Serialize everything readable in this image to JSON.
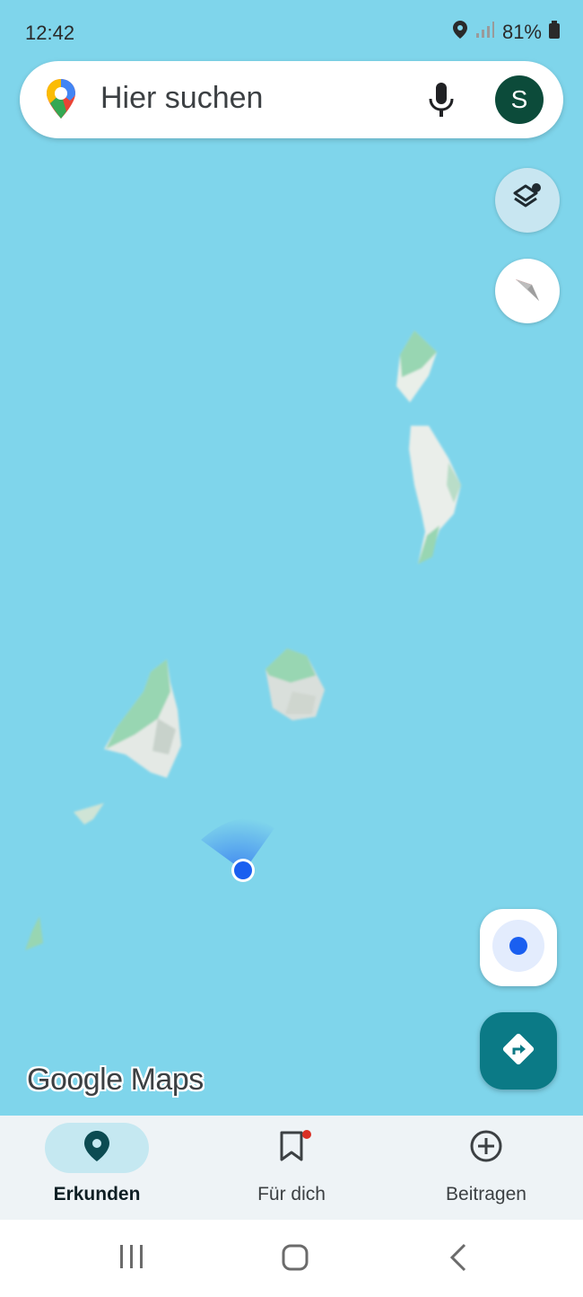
{
  "status_bar": {
    "time": "12:42",
    "battery": "81%",
    "icons": [
      "location-icon",
      "signal-icon",
      "battery-icon"
    ]
  },
  "search": {
    "placeholder": "Hier suchen",
    "avatar_initial": "S",
    "icons": [
      "maps-pin-logo",
      "mic-icon"
    ]
  },
  "map": {
    "watermark": "Google Maps",
    "colors": {
      "water": "#7fd5eb",
      "land": "#e9efe9",
      "vegetation": "#98d6b2",
      "user_dot": "#1a5ff0"
    }
  },
  "map_controls": {
    "layers": "layers-icon",
    "compass": "compass-icon",
    "my_location": "my-location-icon",
    "directions": "directions-icon"
  },
  "bottom_nav": {
    "items": [
      {
        "label": "Erkunden",
        "icon": "explore-pin-icon",
        "active": true
      },
      {
        "label": "Für dich",
        "icon": "bookmark-icon",
        "active": false
      },
      {
        "label": "Beitragen",
        "icon": "add-circle-icon",
        "active": false
      }
    ]
  },
  "system_nav": {
    "icons": [
      "recent-apps-icon",
      "home-icon",
      "back-icon"
    ]
  },
  "colors": {
    "accent": "#0b7a86",
    "avatar": "#0c4b3a",
    "nav_active": "#c5e8f1"
  }
}
